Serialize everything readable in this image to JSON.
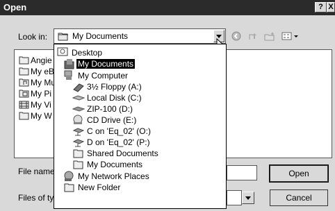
{
  "window": {
    "title": "Open",
    "help": "?",
    "close": "X"
  },
  "look_in": {
    "label": "Look in:",
    "value": "My Documents"
  },
  "file_list": {
    "items": [
      {
        "label": "Angie",
        "icon": "folder-icon"
      },
      {
        "label": "My eB",
        "icon": "folder-icon"
      },
      {
        "label": "My Mu",
        "icon": "music-folder-icon"
      },
      {
        "label": "My Pi",
        "icon": "pictures-folder-icon"
      },
      {
        "label": "My Vi",
        "icon": "video-folder-icon"
      },
      {
        "label": "My W",
        "icon": "folder-icon"
      }
    ]
  },
  "dropdown": {
    "items": [
      {
        "label": "Desktop",
        "icon": "desktop-icon",
        "selected": false
      },
      {
        "label": "My Documents",
        "icon": "my-documents-icon",
        "selected": true
      },
      {
        "label": "My Computer",
        "icon": "computer-icon",
        "selected": false
      },
      {
        "label": "3½ Floppy (A:)",
        "icon": "floppy-icon",
        "selected": false
      },
      {
        "label": "Local Disk (C:)",
        "icon": "disk-icon",
        "selected": false
      },
      {
        "label": "ZIP-100 (D:)",
        "icon": "zip-drive-icon",
        "selected": false
      },
      {
        "label": "CD Drive (E:)",
        "icon": "cd-drive-icon",
        "selected": false
      },
      {
        "label": "C on 'Eq_02' (O:)",
        "icon": "network-drive-icon",
        "selected": false
      },
      {
        "label": "D on 'Eq_02' (P:)",
        "icon": "network-drive-icon",
        "selected": false
      },
      {
        "label": "Shared Documents",
        "icon": "folder-icon",
        "selected": false
      },
      {
        "label": "My Documents",
        "icon": "folder-icon",
        "selected": false
      },
      {
        "label": "My Network Places",
        "icon": "network-places-icon",
        "selected": false
      },
      {
        "label": "New Folder",
        "icon": "folder-icon",
        "selected": false
      }
    ]
  },
  "file_name": {
    "label": "File name"
  },
  "files_of_type": {
    "label": "Files of typ"
  },
  "buttons": {
    "open": "Open",
    "cancel": "Cancel"
  }
}
